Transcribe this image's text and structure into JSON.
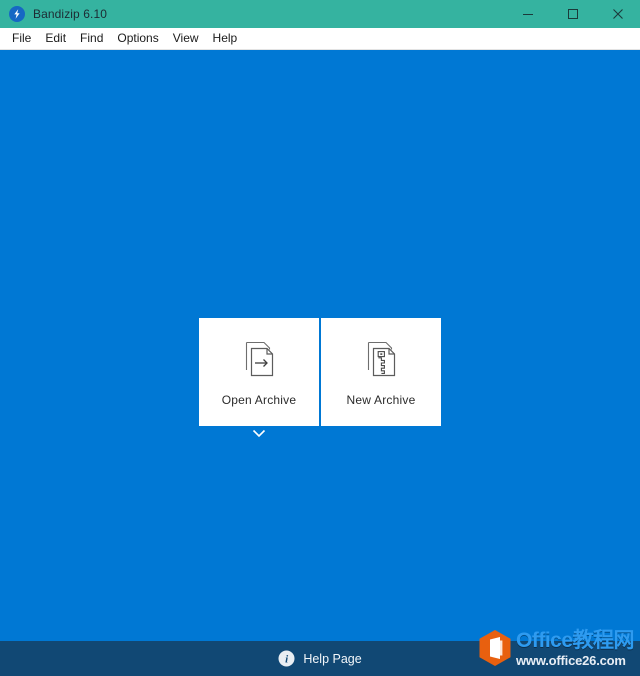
{
  "window": {
    "title": "Bandizip 6.10",
    "app_icon": "bandizip-lightning-icon",
    "accent_titlebar_color": "#35b3a0",
    "canvas_color": "#0078d4",
    "statusbar_color": "#114874",
    "controls": [
      {
        "name": "minimize",
        "label": "–",
        "icon": "minimize-icon"
      },
      {
        "name": "maximize",
        "label": "□",
        "icon": "maximize-icon"
      },
      {
        "name": "close",
        "label": "✕",
        "icon": "close-icon"
      }
    ]
  },
  "menu": {
    "items": [
      {
        "label": "File",
        "name": "menu-file"
      },
      {
        "label": "Edit",
        "name": "menu-edit"
      },
      {
        "label": "Find",
        "name": "menu-find"
      },
      {
        "label": "Options",
        "name": "menu-options"
      },
      {
        "label": "View",
        "name": "menu-view"
      },
      {
        "label": "Help",
        "name": "menu-help"
      }
    ]
  },
  "main": {
    "cards": [
      {
        "label": "Open Archive",
        "icon": "open-archive-icon"
      },
      {
        "label": "New Archive",
        "icon": "new-archive-icon"
      }
    ],
    "expand_icon": "chevron-down-icon"
  },
  "status": {
    "help_label": "Help Page",
    "help_icon": "info-icon"
  },
  "watermark": {
    "title": "Office教程网",
    "url": "www.office26.com",
    "logo": "office-hexagon-logo",
    "title_color": "#2e9bf0",
    "logo_color": "#e8600f"
  }
}
